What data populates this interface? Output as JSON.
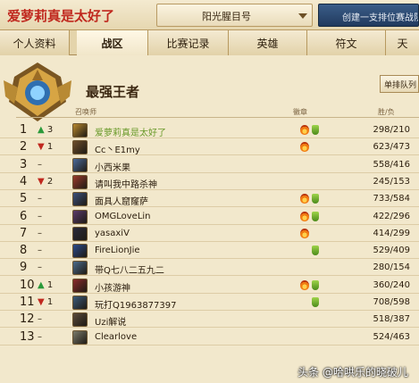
{
  "header": {
    "player_name": "爱萝莉真是太好了",
    "server": "阳光腥目号",
    "create_team_label": "创建一支排位赛战队"
  },
  "tabs": [
    {
      "label": "个人资料"
    },
    {
      "label": "战区"
    },
    {
      "label": "比赛记录"
    },
    {
      "label": "英雄"
    },
    {
      "label": "符文"
    },
    {
      "label": "天"
    }
  ],
  "panel": {
    "tier_title": "最强王者",
    "queue_label": "单排队列",
    "col_summoner": "召唤师",
    "col_badges": "徽章",
    "col_wins": "胜/负"
  },
  "rows": [
    {
      "rank": "1",
      "change_arrow": "▲",
      "change_value": "3",
      "direction": "up",
      "name": "爱萝莉真是太好了",
      "score": "298/210",
      "flame": true,
      "shield": true,
      "me": true,
      "avatar_color": "#b9892e"
    },
    {
      "rank": "2",
      "change_arrow": "▼",
      "change_value": "1",
      "direction": "down",
      "name": "Cc丶E1my",
      "score": "623/473",
      "flame": true,
      "shield": false,
      "me": false,
      "avatar_color": "#6d4e2a"
    },
    {
      "rank": "3",
      "change_arrow": "",
      "change_value": "–",
      "direction": "none",
      "name": "小西米果",
      "score": "558/416",
      "flame": false,
      "shield": false,
      "me": false,
      "avatar_color": "#4a6a9a"
    },
    {
      "rank": "4",
      "change_arrow": "▼",
      "change_value": "2",
      "direction": "down",
      "name": "请叫我中路杀神",
      "score": "245/153",
      "flame": false,
      "shield": false,
      "me": false,
      "avatar_color": "#9a3a2a"
    },
    {
      "rank": "5",
      "change_arrow": "",
      "change_value": "–",
      "direction": "none",
      "name": "面具人窟窿萨",
      "score": "733/584",
      "flame": true,
      "shield": true,
      "me": false,
      "avatar_color": "#3b4f7a"
    },
    {
      "rank": "6",
      "change_arrow": "",
      "change_value": "–",
      "direction": "none",
      "name": "OMGLoveLin",
      "score": "422/296",
      "flame": true,
      "shield": true,
      "me": false,
      "avatar_color": "#5a3a6a"
    },
    {
      "rank": "7",
      "change_arrow": "",
      "change_value": "–",
      "direction": "none",
      "name": "yasaxiV",
      "score": "414/299",
      "flame": true,
      "shield": false,
      "me": false,
      "avatar_color": "#2a2a3a"
    },
    {
      "rank": "8",
      "change_arrow": "",
      "change_value": "–",
      "direction": "none",
      "name": "FireLionJie",
      "score": "529/409",
      "flame": false,
      "shield": true,
      "me": false,
      "avatar_color": "#2a4a8a"
    },
    {
      "rank": "9",
      "change_arrow": "",
      "change_value": "–",
      "direction": "none",
      "name": "带Q七八二五九二",
      "score": "280/154",
      "flame": false,
      "shield": false,
      "me": false,
      "avatar_color": "#4a6a8a"
    },
    {
      "rank": "10",
      "change_arrow": "▲",
      "change_value": "1",
      "direction": "up",
      "name": "小孩游神",
      "score": "360/240",
      "flame": true,
      "shield": true,
      "me": false,
      "avatar_color": "#8a2a2a"
    },
    {
      "rank": "11",
      "change_arrow": "▼",
      "change_value": "1",
      "direction": "down",
      "name": "玩打Q1963877397",
      "score": "708/598",
      "flame": false,
      "shield": true,
      "me": false,
      "avatar_color": "#3a5a7a"
    },
    {
      "rank": "12",
      "change_arrow": "",
      "change_value": "–",
      "direction": "none",
      "name": "Uzi解说",
      "score": "518/387",
      "flame": false,
      "shield": false,
      "me": false,
      "avatar_color": "#5a4a3a"
    },
    {
      "rank": "13",
      "change_arrow": "",
      "change_value": "–",
      "direction": "none",
      "name": "Clearlove",
      "score": "524/463",
      "flame": false,
      "shield": false,
      "me": false,
      "avatar_color": "#7a7a6a"
    }
  ],
  "watermark": "头条 @哈哄乐的晓破儿"
}
